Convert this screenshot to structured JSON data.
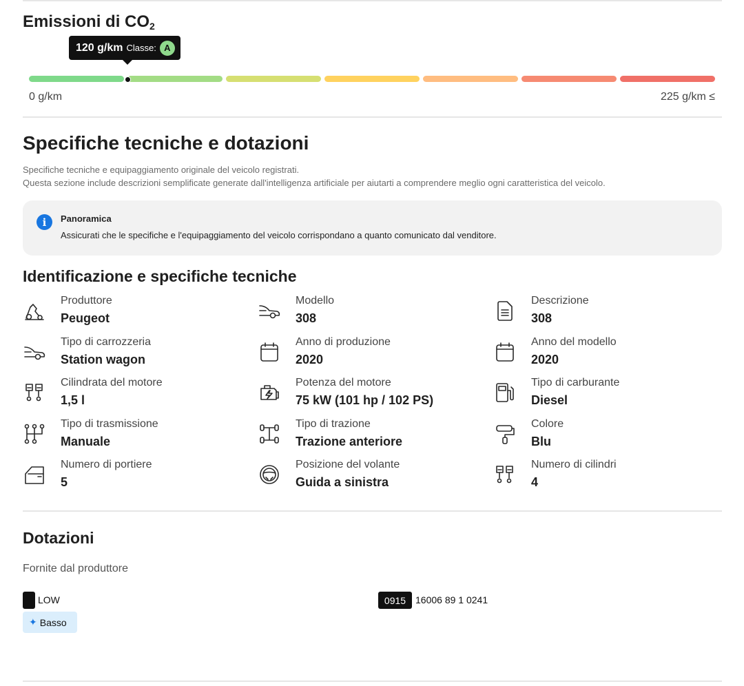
{
  "co2": {
    "title_main": "Emissioni di CO",
    "title_sub": "2",
    "tooltip_value": "120 g/km",
    "tooltip_class_label": "Classe:",
    "tooltip_class": "A",
    "scale_min": "0 g/km",
    "scale_max": "225 g/km ≤",
    "current_value_g_km": 120,
    "segment_colors": [
      "#7fd98a",
      "#a3dc85",
      "#d6df72",
      "#ffd25f",
      "#ffbd80",
      "#f68a72",
      "#f07068"
    ]
  },
  "specs_section": {
    "title": "Specifiche tecniche e dotazioni",
    "desc_line1": "Specifiche tecniche e equipaggiamento originale del veicolo registrati.",
    "desc_line2": "Questa sezione include descrizioni semplificate generate dall'intelligenza artificiale per aiutarti a comprendere meglio ogni caratteristica del veicolo."
  },
  "overview": {
    "icon": "info-icon",
    "title": "Panoramica",
    "text": "Assicurati che le specifiche e l'equipaggiamento del veicolo corrispondano a quanto comunicato dal venditore."
  },
  "identification": {
    "title": "Identificazione e specifiche tecniche",
    "items": [
      {
        "icon": "manufacturer-icon",
        "label": "Produttore",
        "value": "Peugeot"
      },
      {
        "icon": "car-icon",
        "label": "Modello",
        "value": "308"
      },
      {
        "icon": "document-icon",
        "label": "Descrizione",
        "value": "308"
      },
      {
        "icon": "car-body-icon",
        "label": "Tipo di carrozzeria",
        "value": "Station wagon"
      },
      {
        "icon": "calendar-icon",
        "label": "Anno di produzione",
        "value": "2020"
      },
      {
        "icon": "calendar-icon",
        "label": "Anno del modello",
        "value": "2020"
      },
      {
        "icon": "cylinders-icon",
        "label": "Cilindrata del motore",
        "value": "1,5 l"
      },
      {
        "icon": "engine-icon",
        "label": "Potenza del motore",
        "value": "75 kW (101 hp / 102 PS)"
      },
      {
        "icon": "fuel-pump-icon",
        "label": "Tipo di carburante",
        "value": "Diesel"
      },
      {
        "icon": "gearbox-icon",
        "label": "Tipo di trasmissione",
        "value": "Manuale"
      },
      {
        "icon": "drivetrain-icon",
        "label": "Tipo di trazione",
        "value": "Trazione anteriore"
      },
      {
        "icon": "paint-roller-icon",
        "label": "Colore",
        "value": "Blu"
      },
      {
        "icon": "car-door-icon",
        "label": "Numero di portiere",
        "value": "5"
      },
      {
        "icon": "steering-wheel-icon",
        "label": "Posizione del volante",
        "value": "Guida a sinistra"
      },
      {
        "icon": "cylinders-icon",
        "label": "Numero di cilindri",
        "value": "4"
      }
    ]
  },
  "equipment": {
    "title": "Dotazioni",
    "subtitle": "Fornite dal produttore",
    "item1_label": "LOW",
    "item1_ai": "Basso",
    "item2_code": "0915",
    "item2_label": "16006 89 1 0241"
  }
}
